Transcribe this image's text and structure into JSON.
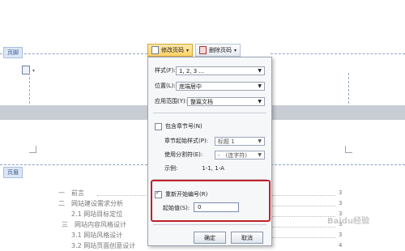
{
  "sections": {
    "footer_label": "页脚",
    "header_label": "页眉"
  },
  "toolbar": {
    "modify_label": "修改页码",
    "delete_label": "删除页码"
  },
  "dialog": {
    "style_label": "样式(F):",
    "style_value": "1, 2, 3 ...",
    "position_label": "位置(L):",
    "position_value": "底端居中",
    "scope_label": "应用范围(Y):",
    "scope_value": "整篇文档",
    "include_chapter_label": "包含章节号(N)",
    "chapter_style_label": "章节起始样式(P):",
    "chapter_style_value": "标题 1",
    "separator_label": "使用分割符(E):",
    "separator_value": "-　(连字符)",
    "example_label": "示例:",
    "example_value": "1-1, 1-A",
    "restart_label": "重新开始编号(R)",
    "start_label": "起始值(S):",
    "start_value": "0",
    "ok_label": "确定",
    "cancel_label": "取消"
  },
  "toc": [
    {
      "text": "一　前言",
      "page": "3"
    },
    {
      "text": "二　网站建设需求分析",
      "page": "3"
    },
    {
      "text": "2.1  网站目标定位",
      "page": "3"
    },
    {
      "text": "三　网站内容风格设计",
      "page": "3"
    },
    {
      "text": "3.1  网站风格设计",
      "page": "3"
    },
    {
      "text": "3.2  网站页面创意设计",
      "page": "4"
    }
  ],
  "watermark": "Baidu经验"
}
